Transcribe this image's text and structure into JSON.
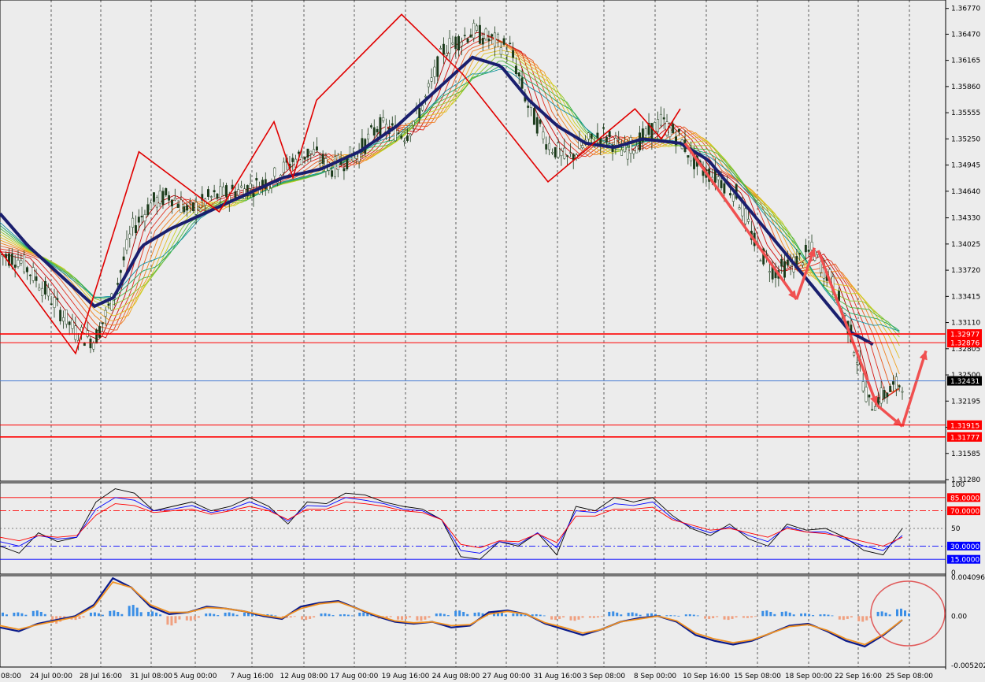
{
  "chart_data": [
    {
      "type": "candlestick",
      "panel": "price",
      "ylim": [
        1.3128,
        1.3685
      ],
      "y_ticks": [
        "1.36770",
        "1.36470",
        "1.36165",
        "1.35860",
        "1.35555",
        "1.35250",
        "1.34945",
        "1.34640",
        "1.34330",
        "1.34025",
        "1.33720",
        "1.33415",
        "1.33110",
        "1.32805",
        "1.32500",
        "1.32195",
        "1.31890",
        "1.31585",
        "1.31280"
      ],
      "x_labels": [
        "08:00",
        "24 Jul 00:00",
        "28 Jul 16:00",
        "31 Jul 08:00",
        "5 Aug 00:00",
        "7 Aug 16:00",
        "12 Aug 08:00",
        "17 Aug 00:00",
        "19 Aug 16:00",
        "24 Aug 08:00",
        "27 Aug 00:00",
        "31 Aug 16:00",
        "3 Sep 08:00",
        "8 Sep 00:00",
        "10 Sep 16:00",
        "15 Sep 08:00",
        "18 Sep 00:00",
        "22 Sep 16:00",
        "25 Sep 08:00"
      ],
      "price_path": [
        [
          0,
          1.339
        ],
        [
          0.02,
          1.3385
        ],
        [
          0.04,
          1.336
        ],
        [
          0.06,
          1.333
        ],
        [
          0.08,
          1.33
        ],
        [
          0.1,
          1.329
        ],
        [
          0.12,
          1.334
        ],
        [
          0.14,
          1.342
        ],
        [
          0.16,
          1.345
        ],
        [
          0.18,
          1.346
        ],
        [
          0.2,
          1.344
        ],
        [
          0.22,
          1.3455
        ],
        [
          0.25,
          1.3465
        ],
        [
          0.27,
          1.347
        ],
        [
          0.29,
          1.348
        ],
        [
          0.31,
          1.35
        ],
        [
          0.33,
          1.351
        ],
        [
          0.35,
          1.349
        ],
        [
          0.38,
          1.351
        ],
        [
          0.4,
          1.354
        ],
        [
          0.43,
          1.353
        ],
        [
          0.45,
          1.357
        ],
        [
          0.47,
          1.363
        ],
        [
          0.5,
          1.365
        ],
        [
          0.52,
          1.364
        ],
        [
          0.54,
          1.363
        ],
        [
          0.56,
          1.356
        ],
        [
          0.58,
          1.352
        ],
        [
          0.6,
          1.35
        ],
        [
          0.62,
          1.352
        ],
        [
          0.64,
          1.353
        ],
        [
          0.66,
          1.351
        ],
        [
          0.68,
          1.3525
        ],
        [
          0.7,
          1.3545
        ],
        [
          0.72,
          1.3525
        ],
        [
          0.74,
          1.349
        ],
        [
          0.76,
          1.348
        ],
        [
          0.78,
          1.346
        ],
        [
          0.8,
          1.34
        ],
        [
          0.82,
          1.337
        ],
        [
          0.84,
          1.338
        ],
        [
          0.86,
          1.3395
        ],
        [
          0.88,
          1.336
        ],
        [
          0.9,
          1.33
        ],
        [
          0.92,
          1.3215
        ],
        [
          0.94,
          1.323
        ],
        [
          0.955,
          1.3242
        ]
      ],
      "ema_ribbon": "12 moving averages (red to green) plus heavy navy long MA",
      "long_ma_path": [
        [
          0,
          1.3438
        ],
        [
          0.03,
          1.34
        ],
        [
          0.06,
          1.337
        ],
        [
          0.1,
          1.333
        ],
        [
          0.12,
          1.334
        ],
        [
          0.15,
          1.34
        ],
        [
          0.18,
          1.342
        ],
        [
          0.22,
          1.344
        ],
        [
          0.26,
          1.346
        ],
        [
          0.3,
          1.348
        ],
        [
          0.34,
          1.349
        ],
        [
          0.38,
          1.351
        ],
        [
          0.42,
          1.354
        ],
        [
          0.46,
          1.358
        ],
        [
          0.5,
          1.362
        ],
        [
          0.53,
          1.361
        ],
        [
          0.56,
          1.357
        ],
        [
          0.59,
          1.354
        ],
        [
          0.62,
          1.352
        ],
        [
          0.65,
          1.3515
        ],
        [
          0.68,
          1.3525
        ],
        [
          0.72,
          1.352
        ],
        [
          0.75,
          1.35
        ],
        [
          0.78,
          1.346
        ],
        [
          0.81,
          1.342
        ],
        [
          0.84,
          1.338
        ],
        [
          0.87,
          1.334
        ],
        [
          0.9,
          1.33
        ],
        [
          0.925,
          1.3285
        ]
      ],
      "zigzag": [
        [
          1.3395,
          0.0
        ],
        [
          1.3275,
          0.08
        ],
        [
          1.351,
          0.147
        ],
        [
          1.344,
          0.232
        ],
        [
          1.3545,
          0.29
        ],
        [
          1.348,
          0.31
        ],
        [
          1.357,
          0.335
        ],
        [
          1.367,
          0.425
        ],
        [
          1.36,
          0.49
        ],
        [
          1.3475,
          0.58
        ],
        [
          1.356,
          0.672
        ],
        [
          1.3525,
          0.7
        ],
        [
          1.356,
          0.72
        ]
      ],
      "arrows": [
        "down 10 Sep -> 18 Sep",
        "up 18 Sep",
        "down 18 Sep -> 25 Sep",
        "down 25 Sep to 1.3189",
        "up 25 Sep to 1.3275"
      ],
      "levels": [
        {
          "label": "1.32977",
          "color": "#ff0000"
        },
        {
          "label": "1.32876",
          "color": "#ff0000"
        },
        {
          "label": "1.32431",
          "color": "#000000",
          "line_color": "#4a7fd4"
        },
        {
          "label": "1.31915",
          "color": "#ff0000"
        },
        {
          "label": "1.31777",
          "color": "#ff0000"
        }
      ]
    },
    {
      "type": "line",
      "panel": "oscillator",
      "ylim": [
        0,
        100
      ],
      "y_ticks": [
        "100",
        "50",
        "0"
      ],
      "levels": [
        {
          "label": "85.0000",
          "value": 85,
          "color": "#ff0000"
        },
        {
          "label": "70.0000",
          "value": 70,
          "color": "#ff0000"
        },
        {
          "label": "30.0000",
          "value": 30,
          "color": "#0000ff"
        },
        {
          "label": "15.0000",
          "value": 15,
          "color": "#0000ff"
        }
      ],
      "series": [
        {
          "color": "#000000",
          "values": [
            30,
            22,
            45,
            35,
            40,
            80,
            95,
            90,
            70,
            75,
            80,
            70,
            75,
            85,
            75,
            55,
            80,
            78,
            90,
            88,
            80,
            75,
            72,
            60,
            18,
            15,
            35,
            30,
            45,
            20,
            75,
            70,
            85,
            80,
            85,
            65,
            50,
            42,
            55,
            38,
            30,
            55,
            48,
            50,
            40,
            25,
            20,
            50
          ]
        },
        {
          "color": "#0000ff",
          "values": [
            35,
            30,
            42,
            38,
            40,
            72,
            85,
            82,
            70,
            72,
            76,
            68,
            72,
            80,
            72,
            58,
            76,
            75,
            85,
            82,
            78,
            72,
            70,
            60,
            25,
            22,
            35,
            32,
            45,
            28,
            70,
            68,
            78,
            76,
            80,
            62,
            52,
            45,
            52,
            42,
            35,
            52,
            46,
            46,
            38,
            30,
            25,
            42
          ]
        },
        {
          "color": "#ff0000",
          "values": [
            40,
            36,
            42,
            40,
            42,
            65,
            78,
            76,
            68,
            70,
            72,
            66,
            70,
            75,
            70,
            60,
            72,
            72,
            80,
            78,
            75,
            70,
            68,
            60,
            32,
            28,
            36,
            35,
            44,
            34,
            64,
            64,
            72,
            72,
            74,
            60,
            54,
            48,
            50,
            45,
            40,
            50,
            46,
            44,
            40,
            35,
            30,
            40
          ]
        }
      ]
    },
    {
      "type": "bar+line",
      "panel": "macd",
      "ylim": [
        -0.005202,
        0.0040965
      ],
      "y_ticks": [
        "0.0040965",
        "0.00",
        "-0.005202"
      ],
      "histogram": [
        0.0005,
        0.0004,
        0.0006,
        -0.0008,
        -0.0004,
        0.0004,
        0.0006,
        0.0012,
        0.0005,
        -0.001,
        -0.0005,
        0.0003,
        0.0004,
        0.0004,
        0.0002,
        -0.0002,
        -0.0004,
        0.0003,
        0.0002,
        0.0004,
        -0.0003,
        -0.0004,
        -0.0005,
        0.0003,
        0.0006,
        0.0004,
        0.0005,
        0.0003,
        0.0002,
        -0.0004,
        -0.0005,
        -0.0002,
        0.0005,
        0.0004,
        0.0003,
        0.0001,
        0.0002,
        -0.0003,
        -0.0004,
        -0.0002,
        0.0006,
        0.0005,
        0.0003,
        0.0002,
        -0.0004,
        -0.0006,
        0.0005,
        0.0008
      ],
      "macd_line": [
        -0.0012,
        -0.0016,
        -0.0008,
        -0.0004,
        0.0,
        0.0012,
        0.004,
        0.003,
        0.001,
        0.0002,
        0.0004,
        0.001,
        0.0008,
        0.0005,
        0.0,
        -0.0003,
        0.001,
        0.0014,
        0.0016,
        0.0008,
        0.0,
        -0.0006,
        -0.0008,
        -0.0006,
        -0.0012,
        -0.001,
        0.0004,
        0.0006,
        0.0002,
        -0.0008,
        -0.0014,
        -0.002,
        -0.0014,
        -0.0006,
        -0.0002,
        0.0,
        -0.0006,
        -0.002,
        -0.0026,
        -0.003,
        -0.0026,
        -0.0018,
        -0.001,
        -0.0008,
        -0.0016,
        -0.0026,
        -0.0032,
        -0.002,
        -0.0004
      ],
      "signal_line": [
        -0.001,
        -0.0014,
        -0.0009,
        -0.0005,
        -0.0001,
        0.001,
        0.0036,
        0.003,
        0.0012,
        0.0004,
        0.0004,
        0.0009,
        0.0008,
        0.0005,
        0.0001,
        -0.0002,
        0.0008,
        0.0013,
        0.0015,
        0.0008,
        0.0001,
        -0.0005,
        -0.0007,
        -0.0006,
        -0.001,
        -0.0009,
        0.0002,
        0.0005,
        0.0002,
        -0.0007,
        -0.0012,
        -0.0018,
        -0.0014,
        -0.0006,
        -0.0003,
        0.0,
        -0.0005,
        -0.0018,
        -0.0024,
        -0.0028,
        -0.0025,
        -0.0018,
        -0.0011,
        -0.0009,
        -0.0015,
        -0.0024,
        -0.003,
        -0.0019,
        -0.0004
      ],
      "annotation": "red ellipse at right edge"
    }
  ]
}
